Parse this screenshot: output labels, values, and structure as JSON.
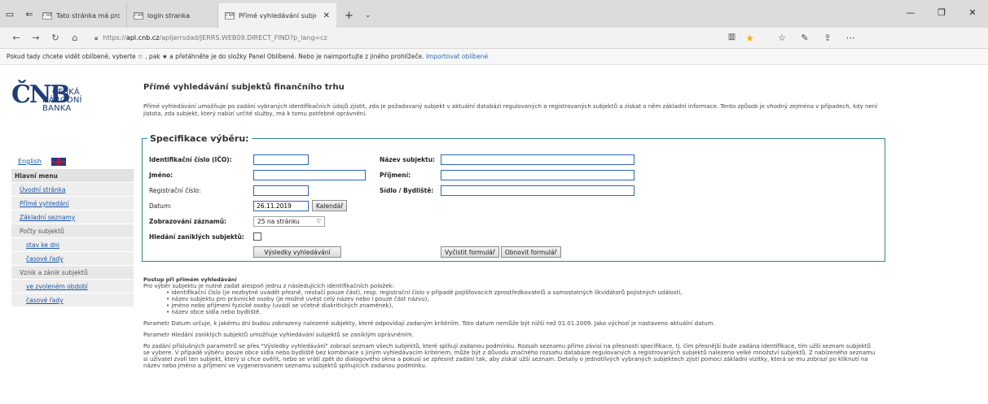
{
  "browser": {
    "tabs": [
      {
        "favicon": "ČNB",
        "label": "Tato stránka má problémy s"
      },
      {
        "favicon": "ČNB",
        "label": "login stranka"
      },
      {
        "favicon": "ČNB",
        "label": "Přímé vyhledávání subje"
      }
    ],
    "url_prefix": "https://",
    "url_host": "apl.cnb.cz",
    "url_rest": "/apljerrsdad/JERRS.WEB09.DIRECT_FIND?p_lang=cz",
    "favorites_bar_text": "Pokud tady chcete vidět oblíbené, vyberte ☆ , pak ★ a přetáhněte je do složky Panel Oblíbené. Nebo je naimportujte z jiného prohlížeče.",
    "favorites_bar_link": "Importovat oblíbené"
  },
  "logo": {
    "mark": "ČNB",
    "line1": "ČESKÁ",
    "line2": "NÁRODNÍ",
    "line3": "BANKA"
  },
  "sidebar": {
    "english": "English",
    "menu_heading": "Hlavní menu",
    "items": [
      {
        "label": "Úvodní stránka"
      },
      {
        "label": "Přímé vyhledání"
      },
      {
        "label": "Základní seznamy"
      }
    ],
    "pocty": "Počty subjektů",
    "pocty_items": [
      {
        "label": "stav ke dni"
      },
      {
        "label": "časové řady"
      }
    ],
    "vznik": "Vznik a zánik subjektů",
    "vznik_items": [
      {
        "label": "ve zvoleném období"
      },
      {
        "label": "časové řady"
      }
    ]
  },
  "main": {
    "title": "Přímé vyhledávání subjektů finančního trhu",
    "intro": "Přímé vyhledávání umožňuje po zadání vybraných identifikačních údajů zjistit, zda je požadovaný subjekt v aktuální databázi regulovaných a registrovaných subjektů a získat o něm základní informace. Tento způsob je vhodný zejména v případech, kdy není jistota, zda subjekt, který nabízí určité služby, má k tomu potřebné oprávnění.",
    "form": {
      "legend": "Specifikace výběru:",
      "ico_label": "Identifikační číslo (IČO):",
      "name_label": "Název subjektu:",
      "jmeno_label": "Jméno:",
      "prijmeni_label": "Příjmení:",
      "reg_label": "Registrační číslo:",
      "sidlo_label": "Sídlo / Bydliště:",
      "datum_label": "Datum:",
      "datum_value": "26.11.2019",
      "kalendar_btn": "Kalendář",
      "zobrazovani_label": "Zobrazování záznamů:",
      "zobrazovani_value": "25 na stránku",
      "zanikle_label": "Hledání zaniklých subjektů:",
      "vysledky_btn": "Výsledky vyhledávání",
      "vycistit_btn": "Vyčistit formulář",
      "obnovit_btn": "Obnovit formulář"
    },
    "help": {
      "heading": "Postup při přímém vyhledávání",
      "lead": "Pro výběr subjektu je nutné zadat alespoň jednu z následujících identifikačních položek:",
      "bullets": [
        "identifikační číslo (je nezbytné uvádět přesně, nestačí pouze část), resp. registrační číslo v případě pojišťovacích zprostředkovatelů a samostatných likvidátorů pojistných událostí,",
        "název subjektu pro právnické osoby (je možné uvést celý název nebo i pouze část názvu),",
        "jméno nebo příjmení fyzické osoby (uvádí se včetně diakritických znamének),",
        "název obce sídla nebo bydliště."
      ],
      "p1": "Parametr Datum určuje, k jakému dni budou zobrazeny nalezené subjekty, které odpovídají zadaným kritériím. Toto datum nemůže být nižší než 01.01.2009. Jako výchozí je nastaveno aktuální datum.",
      "p2": "Parametr Hledání zaniklých subjektů umožňuje vyhledávání subjektů se zaniklým oprávněním.",
      "p3": "Po zadání příslušných parametrů se přes \"Výsledky vyhledávání\" zobrazí seznam všech subjektů, které splňují zadanou podmínku. Rozsah seznamu přímo závisí na přesnosti specifikace, tj. čím přesnější bude zadána identifikace, tím užší seznam subjektů se vybere. V případě výběru pouze obce sídla nebo bydliště bez kombinace s jiným vyhledávacím kritériem, může být z důvodu značného rozsahu databáze regulovaných a registrovaných subjektů nalezeno velké množství subjektů. Z nabízeného seznamu si uživatel zvolí ten subjekt, který si chce ověřit, nebo se vrátí zpět do dialogového okna a pokusí se zpřesnit zadání tak, aby získal užší seznam. Detaily o jednotlivých vybraných subjektech zjistí pomocí základní vizitky, která se mu zobrazí po kliknutí na název nebo jméno a příjmení ve vygenerovaném seznamu subjektů splňujících zadanou podmínku."
    }
  }
}
